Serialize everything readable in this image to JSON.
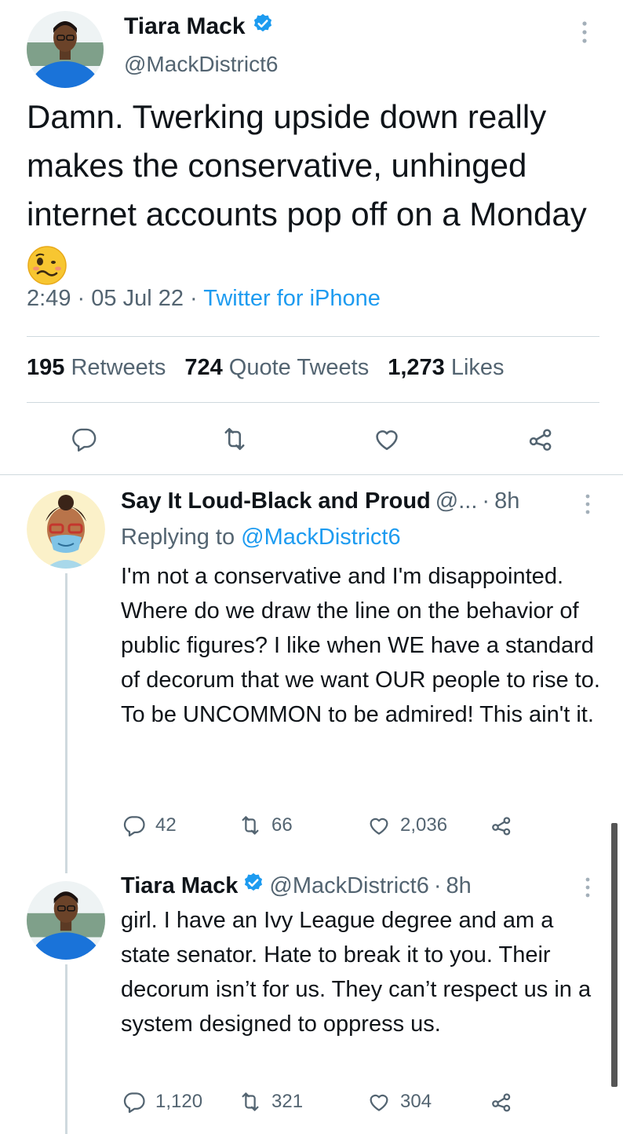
{
  "main_tweet": {
    "author_name": "Tiara Mack",
    "handle": "@MackDistrict6",
    "text": "Damn. Twerking upside down really makes the conservative, unhinged internet accounts pop off on a Monday",
    "time": "2:49",
    "date": "05 Jul 22",
    "client": "Twitter for iPhone",
    "separator": "·",
    "stats": {
      "retweets_count": "195",
      "retweets_label": "Retweets",
      "quotes_count": "724",
      "quotes_label": "Quote Tweets",
      "likes_count": "1,273",
      "likes_label": "Likes"
    }
  },
  "replies": [
    {
      "author_name": "Say It Loud-Black and Proud",
      "handle": "@...",
      "age": "8h",
      "replying_prefix": "Replying to",
      "replying_to": "@MackDistrict6",
      "text": "I'm not a conservative and I'm disappointed.  Where do we draw the line on the behavior of public figures?  I like when WE have a standard of decorum that we want OUR people to rise to. To be UNCOMMON to be admired!  This ain't it.",
      "reply_count": "42",
      "retweet_count": "66",
      "like_count": "2,036"
    },
    {
      "author_name": "Tiara Mack",
      "handle": "@MackDistrict6",
      "age": "8h",
      "text": "girl. I have an Ivy League degree and am a state senator. Hate to break it to you. Their decorum isn’t for us. They can’t respect us in a system designed to oppress us.",
      "reply_count": "1,120",
      "retweet_count": "321",
      "like_count": "304"
    }
  ],
  "colors": {
    "accent": "#1d9bf0",
    "text": "#0f1419",
    "secondary": "#536471",
    "divider": "#cfd9de"
  },
  "icons": [
    "verified-badge-icon",
    "more-options-icon",
    "reply-icon",
    "retweet-icon",
    "like-icon",
    "share-icon",
    "woozy-face-emoji"
  ]
}
